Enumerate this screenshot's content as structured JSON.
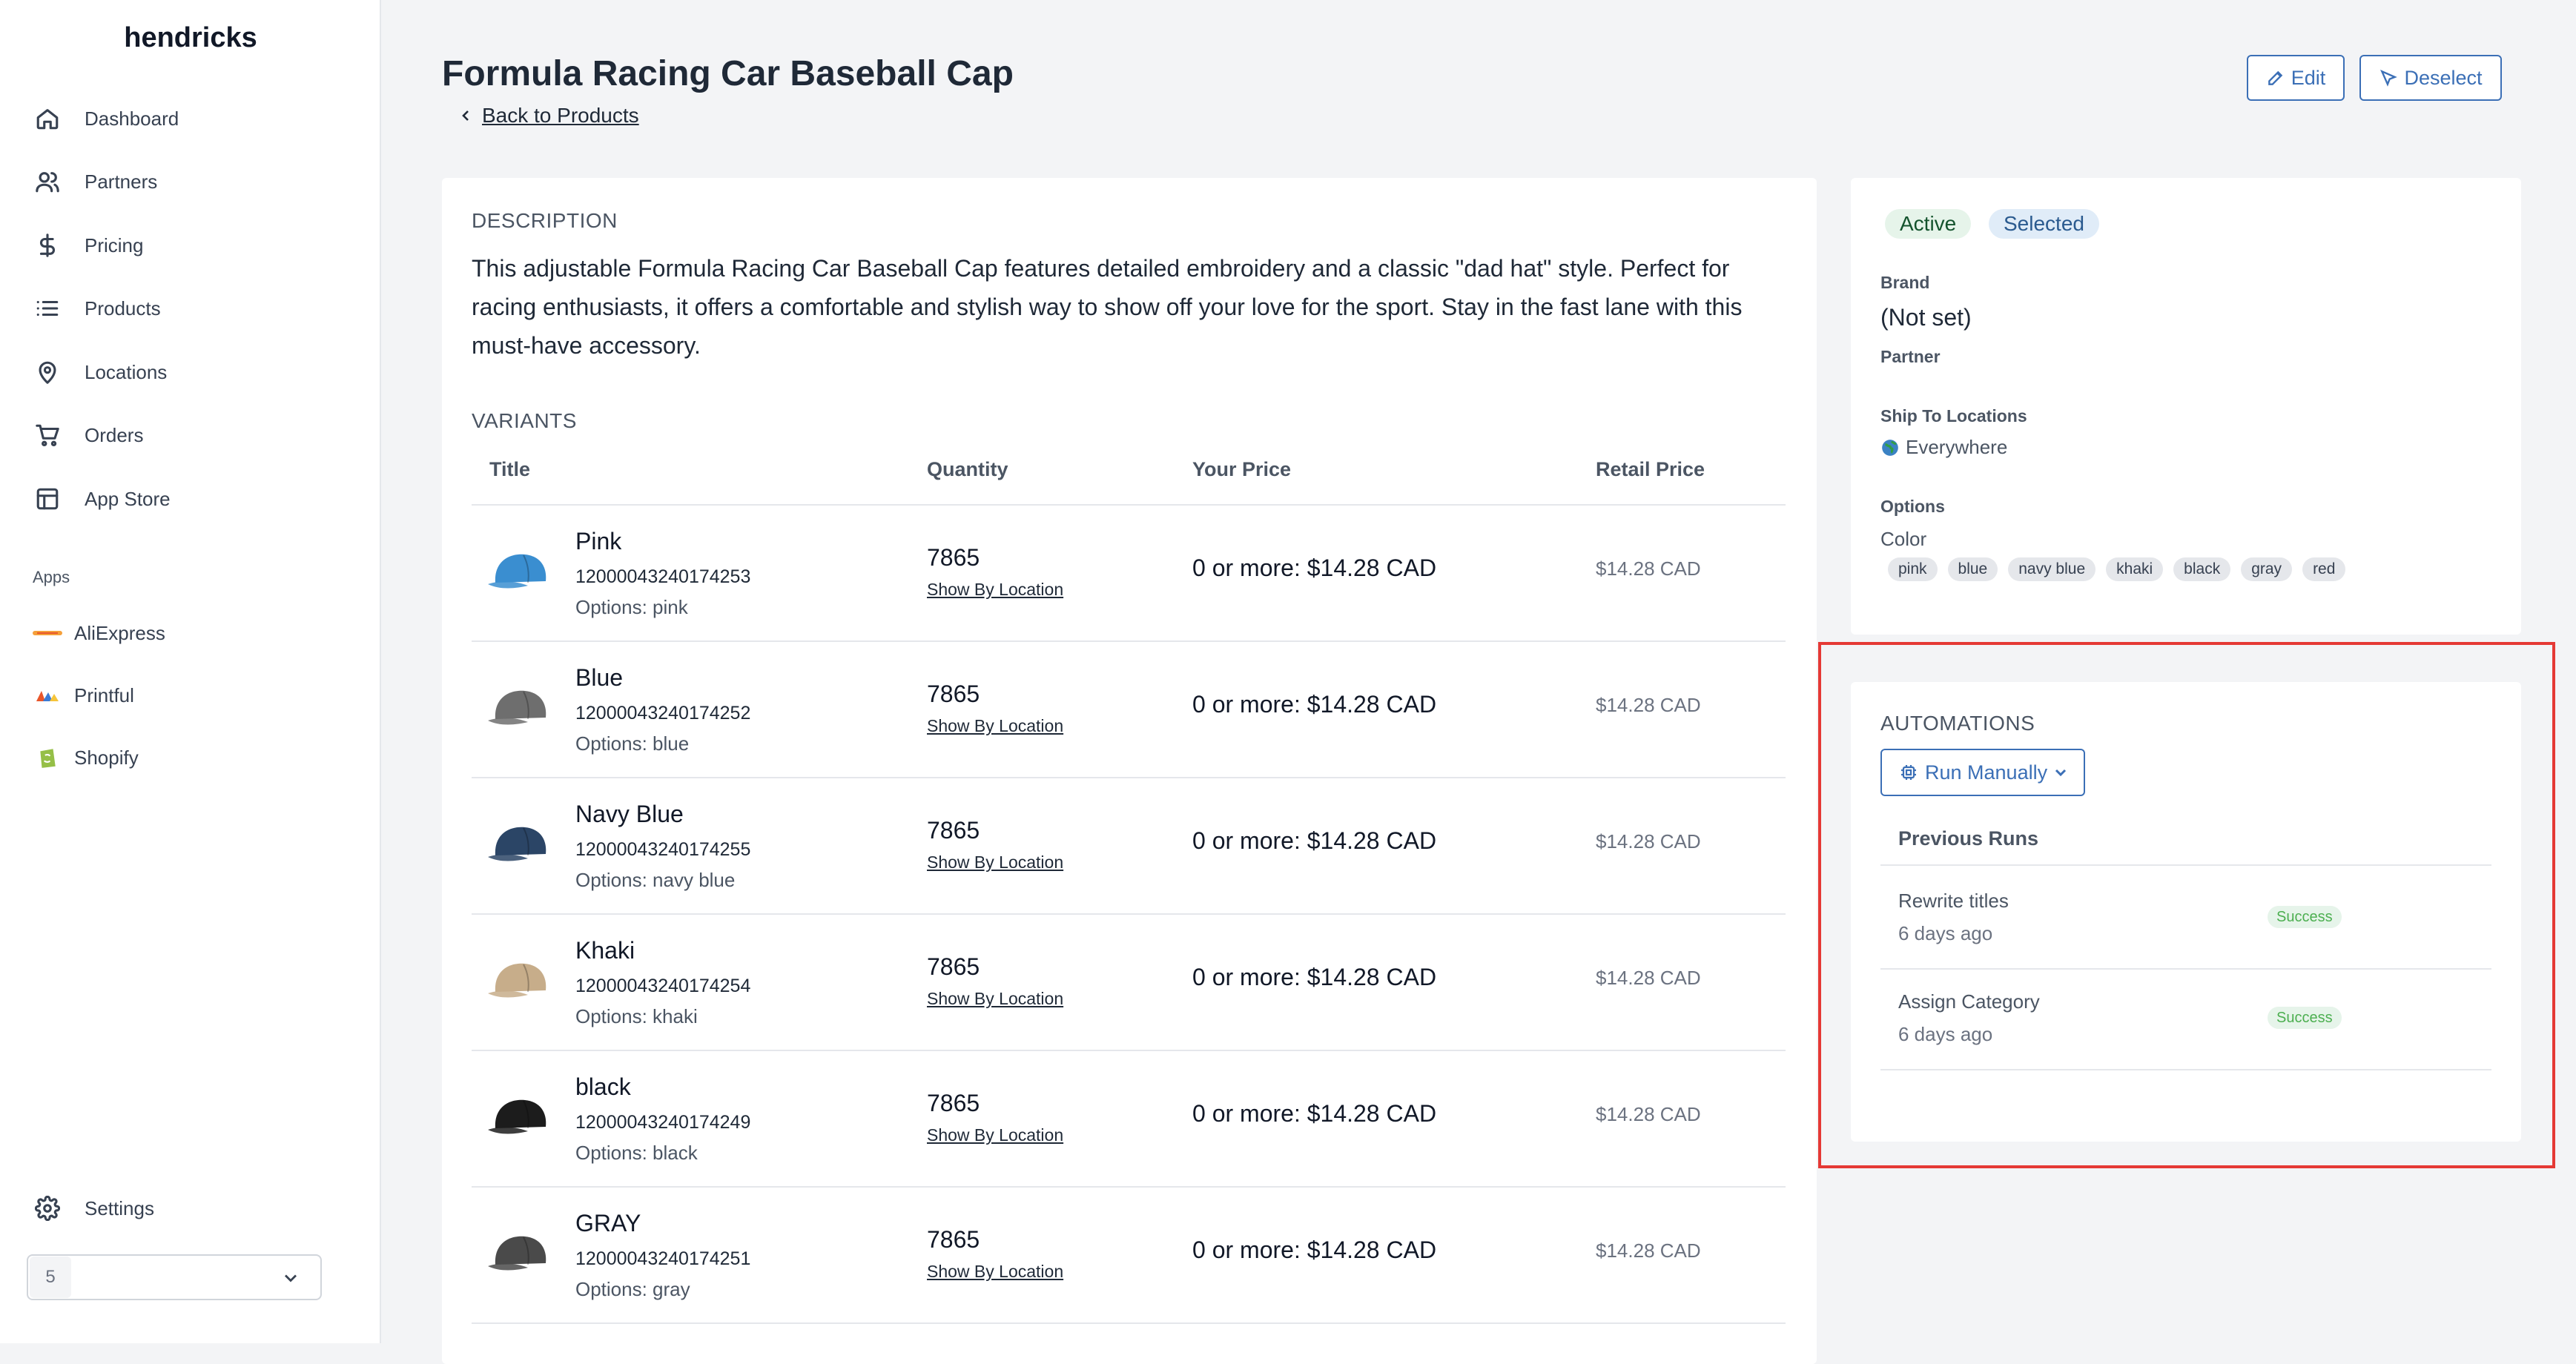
{
  "sidebar": {
    "brand": "hendricks",
    "nav": [
      {
        "label": "Dashboard",
        "icon": "home-icon"
      },
      {
        "label": "Partners",
        "icon": "users-icon"
      },
      {
        "label": "Pricing",
        "icon": "dollar-icon"
      },
      {
        "label": "Products",
        "icon": "list-icon"
      },
      {
        "label": "Locations",
        "icon": "map-pin-icon"
      },
      {
        "label": "Orders",
        "icon": "cart-icon"
      },
      {
        "label": "App Store",
        "icon": "layout-icon"
      }
    ],
    "apps_label": "Apps",
    "apps": [
      {
        "label": "AliExpress",
        "icon": "aliexpress-icon"
      },
      {
        "label": "Printful",
        "icon": "printful-icon"
      },
      {
        "label": "Shopify",
        "icon": "shopify-icon"
      }
    ],
    "settings_label": "Settings",
    "org_badge": "5"
  },
  "header": {
    "title": "Formula Racing Car Baseball Cap",
    "back_label": "Back to Products",
    "edit_label": "Edit",
    "deselect_label": "Deselect"
  },
  "main": {
    "description_label": "DESCRIPTION",
    "description": "This adjustable Formula Racing Car Baseball Cap features detailed embroidery and a classic \"dad hat\" style. Perfect for racing enthusiasts, it offers a comfortable and stylish way to show off your love for the sport. Stay in the fast lane with this must-have accessory.",
    "variants_label": "VARIANTS",
    "columns": [
      "Title",
      "Quantity",
      "Your Price",
      "Retail Price"
    ],
    "variants": [
      {
        "title": "Pink",
        "sku": "12000043240174253",
        "options": "Options: pink",
        "qty": "7865",
        "loc": "Show By Location",
        "price": "0 or more: $14.28 CAD",
        "retail": "$14.28 CAD",
        "color": "#3a8ed0"
      },
      {
        "title": "Blue",
        "sku": "12000043240174252",
        "options": "Options: blue",
        "qty": "7865",
        "loc": "Show By Location",
        "price": "0 or more: $14.28 CAD",
        "retail": "$14.28 CAD",
        "color": "#6e6e6e"
      },
      {
        "title": "Navy Blue",
        "sku": "12000043240174255",
        "options": "Options: navy blue",
        "qty": "7865",
        "loc": "Show By Location",
        "price": "0 or more: $14.28 CAD",
        "retail": "$14.28 CAD",
        "color": "#2b4566"
      },
      {
        "title": "Khaki",
        "sku": "12000043240174254",
        "options": "Options: khaki",
        "qty": "7865",
        "loc": "Show By Location",
        "price": "0 or more: $14.28 CAD",
        "retail": "$14.28 CAD",
        "color": "#c7ad8a"
      },
      {
        "title": "black",
        "sku": "12000043240174249",
        "options": "Options: black",
        "qty": "7865",
        "loc": "Show By Location",
        "price": "0 or more: $14.28 CAD",
        "retail": "$14.28 CAD",
        "color": "#1c1c1c"
      },
      {
        "title": "GRAY",
        "sku": "12000043240174251",
        "options": "Options: gray",
        "qty": "7865",
        "loc": "Show By Location",
        "price": "0 or more: $14.28 CAD",
        "retail": "$14.28 CAD",
        "color": "#4a4a4a"
      }
    ]
  },
  "details": {
    "status_active": "Active",
    "status_selected": "Selected",
    "brand_label": "Brand",
    "brand_value": "(Not set)",
    "partner_label": "Partner",
    "ship_label": "Ship To Locations",
    "ship_value": "Everywhere",
    "options_label": "Options",
    "color_label": "Color",
    "colors": [
      "pink",
      "blue",
      "navy blue",
      "khaki",
      "black",
      "gray",
      "red"
    ]
  },
  "automations": {
    "label": "AUTOMATIONS",
    "run_label": "Run Manually",
    "previous_label": "Previous Runs",
    "runs": [
      {
        "name": "Rewrite titles",
        "time": "6 days ago",
        "status": "Success"
      },
      {
        "name": "Assign Category",
        "time": "6 days ago",
        "status": "Success"
      }
    ]
  },
  "colors": {
    "accent": "#3b6fb6",
    "highlight": "#e53935",
    "success": "#4caf50"
  }
}
